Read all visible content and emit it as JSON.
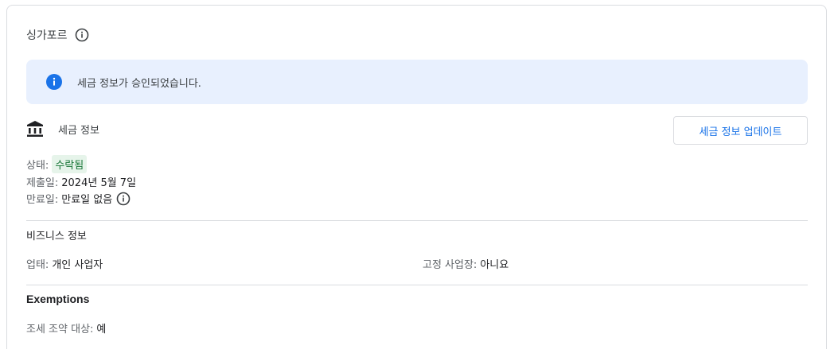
{
  "header": {
    "title": "싱가포르",
    "info_icon": "info-outline-icon"
  },
  "banner": {
    "icon": "info-filled-icon",
    "text": "세금 정보가 승인되었습니다.",
    "color": "#1a73e8"
  },
  "tax_info": {
    "icon": "bank-icon",
    "title": "세금 정보",
    "update_button": "세금 정보 업데이트",
    "status_label": "상태:",
    "status_value": "수락됨",
    "submitted_label": "제출일:",
    "submitted_value": "2024년 5월 7일",
    "expiry_label": "만료일:",
    "expiry_value": "만료일 없음"
  },
  "business_info": {
    "title": "비즈니스 정보",
    "type_label": "업태:",
    "type_value": "개인 사업자",
    "fixed_label": "고정 사업장:",
    "fixed_value": "아니요"
  },
  "exemptions": {
    "title": "Exemptions",
    "treaty_label": "조세 조약 대상:",
    "treaty_value": "예"
  }
}
